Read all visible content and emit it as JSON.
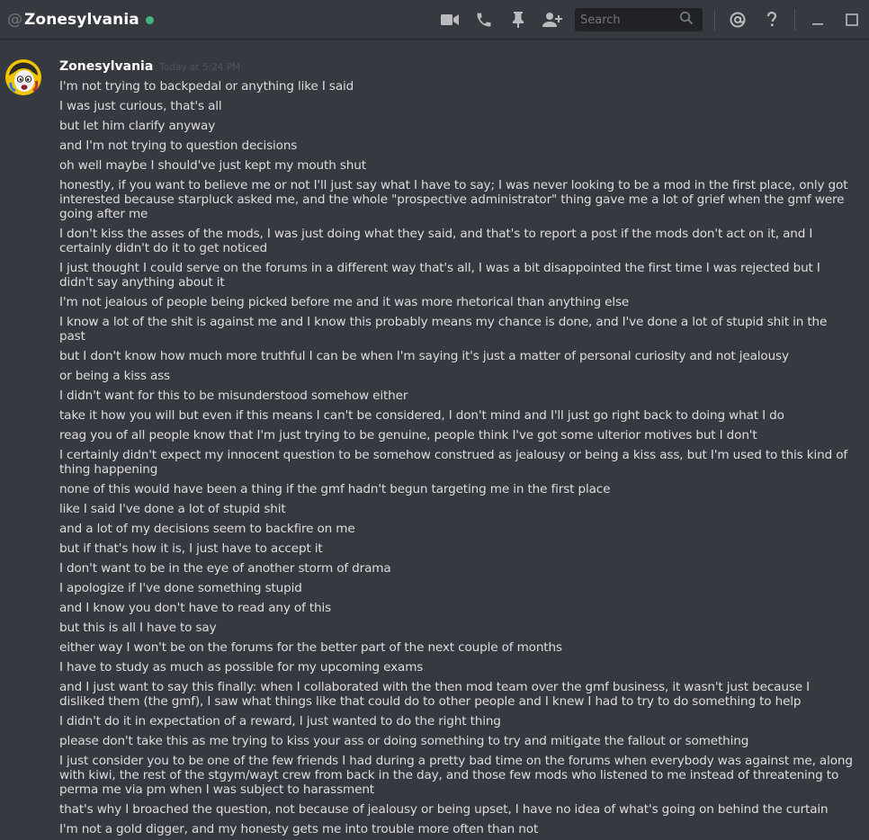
{
  "header": {
    "at_symbol": "@",
    "channel_name": "Zonesylvania",
    "search_placeholder": "Search",
    "status_color": "#43b581"
  },
  "toolbar_icons": [
    "video-call-icon",
    "phone-call-icon",
    "pin-icon",
    "add-friend-icon",
    "search-icon",
    "mention-icon",
    "help-icon",
    "minimize-icon",
    "maximize-icon"
  ],
  "message": {
    "author": "Zonesylvania",
    "timestamp": "Today at 5:24 PM",
    "lines": [
      "I'm not trying to backpedal or anything like I said",
      "I was just curious, that's all",
      "but let him clarify anyway",
      "and I'm not trying to question decisions",
      "oh well maybe I should've just kept my mouth shut",
      "honestly, if you want to believe me or not I'll just say what I have to say; I was never looking to be a mod in the first place, only got interested because starpluck asked me, and the whole \"prospective administrator\" thing gave me a lot of grief when the gmf were going after me",
      "I don't kiss the asses of the mods, I was just doing what they said, and that's to report a post if the mods don't act on it, and I certainly didn't do it to get noticed",
      "I just thought I could serve on the forums in a different way that's all, I was a bit disappointed the first time I was rejected but I didn't say anything about it",
      "I'm not jealous of people being picked before me and it was more rhetorical than anything else",
      "I know a lot of the shit is against me and I know this probably means my chance is done, and I've done a lot of stupid shit in the past",
      "but I don't know how much more truthful I can be when I'm saying it's just a matter of personal curiosity and not jealousy",
      "or being a kiss ass",
      "I didn't want for this to be misunderstood somehow either",
      "take it how you will but even if this means I can't be considered, I don't mind and I'll just go right back to doing what I do",
      "reag you of all people know that I'm just trying to be genuine, people think I've got some ulterior motives but I don't",
      "I certainly didn't expect my innocent question to be somehow construed as jealousy or being a kiss ass, but I'm used to this kind of thing happening",
      "none of this would have been a thing if the gmf hadn't begun targeting me in the first place",
      "like I said I've done a lot of stupid shit",
      "and a lot of my decisions seem to backfire on me",
      "but if that's how it is, I just have to accept it",
      "I don't want to be in the eye of another storm of drama",
      "I apologize if I've done something stupid",
      "and I know you don't have to read any of this",
      "but this is all I have to say",
      "either way I won't be on the forums for the better part of the next couple of months",
      "I have to study as much as possible for my upcoming exams",
      "and I just want to say this finally: when I collaborated with the then mod team over the gmf business, it wasn't just because I disliked them (the gmf), I saw what things like that could do to other people and I knew I had to try to do something to help",
      "I didn't do it in expectation of a reward, I just wanted to do the right thing",
      "please don't take this as me trying to kiss your ass or doing something to try and mitigate the fallout or something",
      "I just consider you to be one of the few friends I had during a pretty bad time on the forums when everybody was against me, along with kiwi, the rest of the stgym/wayt crew from back in the day, and those few mods who listened to me instead of threatening to perma me via pm when I was subject to harassment",
      "that's why I broached the question, not because of jealousy or being upset, I have no idea of what's going on behind the curtain",
      "I'm not a gold digger, and my honesty gets me into trouble more often than not"
    ]
  }
}
